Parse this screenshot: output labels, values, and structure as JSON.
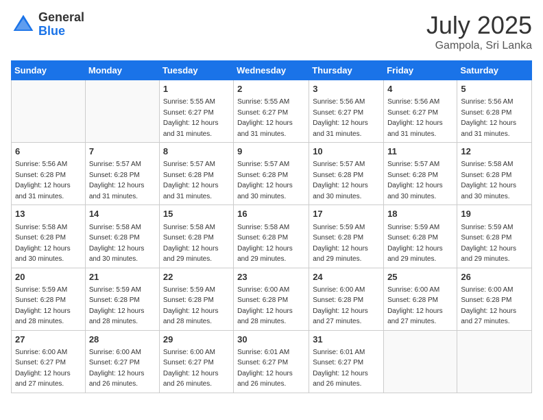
{
  "header": {
    "logo": {
      "general": "General",
      "blue": "Blue"
    },
    "title": "July 2025",
    "location": "Gampola, Sri Lanka"
  },
  "weekdays": [
    "Sunday",
    "Monday",
    "Tuesday",
    "Wednesday",
    "Thursday",
    "Friday",
    "Saturday"
  ],
  "weeks": [
    [
      {
        "day": null
      },
      {
        "day": null
      },
      {
        "day": "1",
        "sunrise": "Sunrise: 5:55 AM",
        "sunset": "Sunset: 6:27 PM",
        "daylight": "Daylight: 12 hours and 31 minutes."
      },
      {
        "day": "2",
        "sunrise": "Sunrise: 5:55 AM",
        "sunset": "Sunset: 6:27 PM",
        "daylight": "Daylight: 12 hours and 31 minutes."
      },
      {
        "day": "3",
        "sunrise": "Sunrise: 5:56 AM",
        "sunset": "Sunset: 6:27 PM",
        "daylight": "Daylight: 12 hours and 31 minutes."
      },
      {
        "day": "4",
        "sunrise": "Sunrise: 5:56 AM",
        "sunset": "Sunset: 6:27 PM",
        "daylight": "Daylight: 12 hours and 31 minutes."
      },
      {
        "day": "5",
        "sunrise": "Sunrise: 5:56 AM",
        "sunset": "Sunset: 6:28 PM",
        "daylight": "Daylight: 12 hours and 31 minutes."
      }
    ],
    [
      {
        "day": "6",
        "sunrise": "Sunrise: 5:56 AM",
        "sunset": "Sunset: 6:28 PM",
        "daylight": "Daylight: 12 hours and 31 minutes."
      },
      {
        "day": "7",
        "sunrise": "Sunrise: 5:57 AM",
        "sunset": "Sunset: 6:28 PM",
        "daylight": "Daylight: 12 hours and 31 minutes."
      },
      {
        "day": "8",
        "sunrise": "Sunrise: 5:57 AM",
        "sunset": "Sunset: 6:28 PM",
        "daylight": "Daylight: 12 hours and 31 minutes."
      },
      {
        "day": "9",
        "sunrise": "Sunrise: 5:57 AM",
        "sunset": "Sunset: 6:28 PM",
        "daylight": "Daylight: 12 hours and 30 minutes."
      },
      {
        "day": "10",
        "sunrise": "Sunrise: 5:57 AM",
        "sunset": "Sunset: 6:28 PM",
        "daylight": "Daylight: 12 hours and 30 minutes."
      },
      {
        "day": "11",
        "sunrise": "Sunrise: 5:57 AM",
        "sunset": "Sunset: 6:28 PM",
        "daylight": "Daylight: 12 hours and 30 minutes."
      },
      {
        "day": "12",
        "sunrise": "Sunrise: 5:58 AM",
        "sunset": "Sunset: 6:28 PM",
        "daylight": "Daylight: 12 hours and 30 minutes."
      }
    ],
    [
      {
        "day": "13",
        "sunrise": "Sunrise: 5:58 AM",
        "sunset": "Sunset: 6:28 PM",
        "daylight": "Daylight: 12 hours and 30 minutes."
      },
      {
        "day": "14",
        "sunrise": "Sunrise: 5:58 AM",
        "sunset": "Sunset: 6:28 PM",
        "daylight": "Daylight: 12 hours and 30 minutes."
      },
      {
        "day": "15",
        "sunrise": "Sunrise: 5:58 AM",
        "sunset": "Sunset: 6:28 PM",
        "daylight": "Daylight: 12 hours and 29 minutes."
      },
      {
        "day": "16",
        "sunrise": "Sunrise: 5:58 AM",
        "sunset": "Sunset: 6:28 PM",
        "daylight": "Daylight: 12 hours and 29 minutes."
      },
      {
        "day": "17",
        "sunrise": "Sunrise: 5:59 AM",
        "sunset": "Sunset: 6:28 PM",
        "daylight": "Daylight: 12 hours and 29 minutes."
      },
      {
        "day": "18",
        "sunrise": "Sunrise: 5:59 AM",
        "sunset": "Sunset: 6:28 PM",
        "daylight": "Daylight: 12 hours and 29 minutes."
      },
      {
        "day": "19",
        "sunrise": "Sunrise: 5:59 AM",
        "sunset": "Sunset: 6:28 PM",
        "daylight": "Daylight: 12 hours and 29 minutes."
      }
    ],
    [
      {
        "day": "20",
        "sunrise": "Sunrise: 5:59 AM",
        "sunset": "Sunset: 6:28 PM",
        "daylight": "Daylight: 12 hours and 28 minutes."
      },
      {
        "day": "21",
        "sunrise": "Sunrise: 5:59 AM",
        "sunset": "Sunset: 6:28 PM",
        "daylight": "Daylight: 12 hours and 28 minutes."
      },
      {
        "day": "22",
        "sunrise": "Sunrise: 5:59 AM",
        "sunset": "Sunset: 6:28 PM",
        "daylight": "Daylight: 12 hours and 28 minutes."
      },
      {
        "day": "23",
        "sunrise": "Sunrise: 6:00 AM",
        "sunset": "Sunset: 6:28 PM",
        "daylight": "Daylight: 12 hours and 28 minutes."
      },
      {
        "day": "24",
        "sunrise": "Sunrise: 6:00 AM",
        "sunset": "Sunset: 6:28 PM",
        "daylight": "Daylight: 12 hours and 27 minutes."
      },
      {
        "day": "25",
        "sunrise": "Sunrise: 6:00 AM",
        "sunset": "Sunset: 6:28 PM",
        "daylight": "Daylight: 12 hours and 27 minutes."
      },
      {
        "day": "26",
        "sunrise": "Sunrise: 6:00 AM",
        "sunset": "Sunset: 6:28 PM",
        "daylight": "Daylight: 12 hours and 27 minutes."
      }
    ],
    [
      {
        "day": "27",
        "sunrise": "Sunrise: 6:00 AM",
        "sunset": "Sunset: 6:27 PM",
        "daylight": "Daylight: 12 hours and 27 minutes."
      },
      {
        "day": "28",
        "sunrise": "Sunrise: 6:00 AM",
        "sunset": "Sunset: 6:27 PM",
        "daylight": "Daylight: 12 hours and 26 minutes."
      },
      {
        "day": "29",
        "sunrise": "Sunrise: 6:00 AM",
        "sunset": "Sunset: 6:27 PM",
        "daylight": "Daylight: 12 hours and 26 minutes."
      },
      {
        "day": "30",
        "sunrise": "Sunrise: 6:01 AM",
        "sunset": "Sunset: 6:27 PM",
        "daylight": "Daylight: 12 hours and 26 minutes."
      },
      {
        "day": "31",
        "sunrise": "Sunrise: 6:01 AM",
        "sunset": "Sunset: 6:27 PM",
        "daylight": "Daylight: 12 hours and 26 minutes."
      },
      {
        "day": null
      },
      {
        "day": null
      }
    ]
  ]
}
